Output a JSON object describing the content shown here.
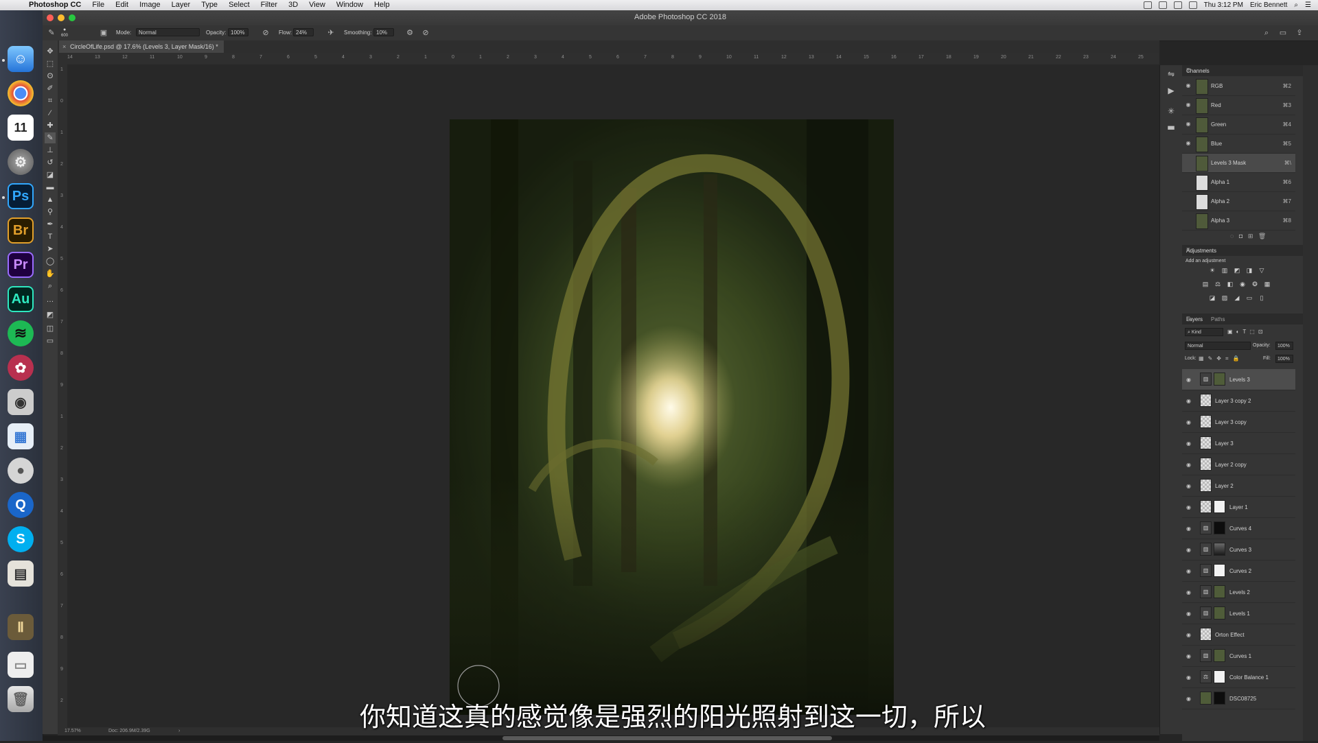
{
  "menubar": {
    "apple": "",
    "app_name": "Photoshop CC",
    "items": [
      "File",
      "Edit",
      "Image",
      "Layer",
      "Type",
      "Select",
      "Filter",
      "3D",
      "View",
      "Window",
      "Help"
    ],
    "clock": "Thu 3:12 PM",
    "user": "Eric Bennett"
  },
  "window": {
    "title": "Adobe Photoshop CC 2018",
    "colors": {
      "close": "#ff5f57",
      "minimize": "#febc2e",
      "zoom": "#28c840"
    }
  },
  "options": {
    "brush_size": "600",
    "mode_label": "Mode:",
    "mode_value": "Normal",
    "opacity_label": "Opacity:",
    "opacity_value": "100%",
    "flow_label": "Flow:",
    "flow_value": "24%",
    "smoothing_label": "Smoothing:",
    "smoothing_value": "10%"
  },
  "document": {
    "tab_label": "CircleOfLife.psd @ 17.6% (Levels 3, Layer Mask/16) *",
    "close_glyph": "×",
    "zoom": "17.57%",
    "doc_size": "Doc: 206.9M/2.39G",
    "status_arrow": "›"
  },
  "ruler": {
    "top": [
      "14",
      "13",
      "12",
      "11",
      "10",
      "9",
      "8",
      "7",
      "6",
      "5",
      "4",
      "3",
      "2",
      "1",
      "0",
      "1",
      "2",
      "3",
      "4",
      "5",
      "6",
      "7",
      "8",
      "9",
      "10",
      "11",
      "12",
      "13",
      "14",
      "15",
      "16",
      "17",
      "18",
      "19",
      "20",
      "21",
      "22",
      "23",
      "24",
      "25"
    ],
    "left": [
      "1",
      "0",
      "1",
      "2",
      "3",
      "4",
      "5",
      "6",
      "7",
      "8",
      "9",
      "1",
      "2",
      "3",
      "4",
      "5",
      "6",
      "7",
      "8",
      "9",
      "2"
    ]
  },
  "subtitle": "你知道这真的感觉像是强烈的阳光照射到这一切，所以",
  "channels": {
    "title": "Channels",
    "rows": [
      {
        "name": "RGB",
        "key": "⌘2",
        "visible": true,
        "thumb": "photo"
      },
      {
        "name": "Red",
        "key": "⌘3",
        "visible": true,
        "thumb": "photo"
      },
      {
        "name": "Green",
        "key": "⌘4",
        "visible": true,
        "thumb": "photo"
      },
      {
        "name": "Blue",
        "key": "⌘5",
        "visible": true,
        "thumb": "photo"
      },
      {
        "name": "Levels 3 Mask",
        "key": "⌘\\",
        "visible": false,
        "thumb": "photo"
      },
      {
        "name": "Alpha 1",
        "key": "⌘6",
        "visible": false,
        "thumb": "white"
      },
      {
        "name": "Alpha 2",
        "key": "⌘7",
        "visible": false,
        "thumb": "white"
      },
      {
        "name": "Alpha 3",
        "key": "⌘8",
        "visible": false,
        "thumb": "photo"
      }
    ]
  },
  "adjustments": {
    "title": "Adjustments",
    "subtitle": "Add an adjustment"
  },
  "layers": {
    "tab_layers": "Layers",
    "tab_paths": "Paths",
    "filter_kind": "Kind",
    "blend_mode": "Normal",
    "opacity_label": "Opacity:",
    "opacity_value": "100%",
    "lock_label": "Lock:",
    "fill_label": "Fill:",
    "fill_value": "100%",
    "rows": [
      {
        "name": "Levels 3",
        "type": "adj",
        "mask": "photo",
        "selected": true
      },
      {
        "name": "Layer 3 copy 2",
        "type": "pixel",
        "selected": false
      },
      {
        "name": "Layer 3 copy",
        "type": "pixel",
        "selected": false
      },
      {
        "name": "Layer 3",
        "type": "pixel",
        "selected": false
      },
      {
        "name": "Layer 2 copy",
        "type": "pixel",
        "selected": false
      },
      {
        "name": "Layer 2",
        "type": "pixel",
        "selected": false
      },
      {
        "name": "Layer 1",
        "type": "pixelmask",
        "mask": "white",
        "selected": false
      },
      {
        "name": "Curves 4",
        "type": "adj",
        "mask": "black",
        "selected": false
      },
      {
        "name": "Curves 3",
        "type": "adj",
        "mask": "gray",
        "selected": false
      },
      {
        "name": "Curves 2",
        "type": "adj",
        "mask": "white",
        "selected": false
      },
      {
        "name": "Levels 2",
        "type": "adj",
        "mask": "photo",
        "selected": false
      },
      {
        "name": "Levels 1",
        "type": "adj",
        "mask": "photo",
        "selected": false
      },
      {
        "name": "Orton Effect",
        "type": "pixel",
        "selected": false
      },
      {
        "name": "Curves 1",
        "type": "adj",
        "mask": "photo",
        "selected": false
      },
      {
        "name": "Color Balance 1",
        "type": "adj2",
        "mask": "white",
        "selected": false
      },
      {
        "name": "DSC08725",
        "type": "photo",
        "selected": false
      }
    ]
  }
}
